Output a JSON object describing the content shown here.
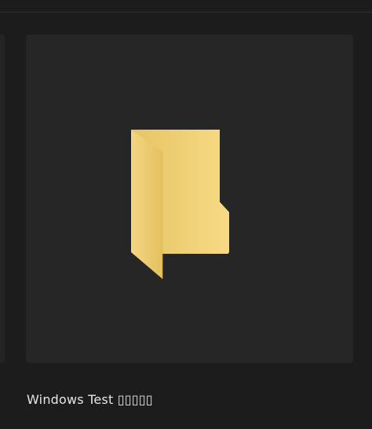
{
  "folder": {
    "name": "Windows Test ▯▯▯▯▯",
    "icon": "folder-icon"
  },
  "colors": {
    "background": "#1c1c1c",
    "tile": "#262626",
    "folder_back": "#f3d277",
    "folder_front": "#e9c766",
    "text": "#e6e6e6"
  }
}
